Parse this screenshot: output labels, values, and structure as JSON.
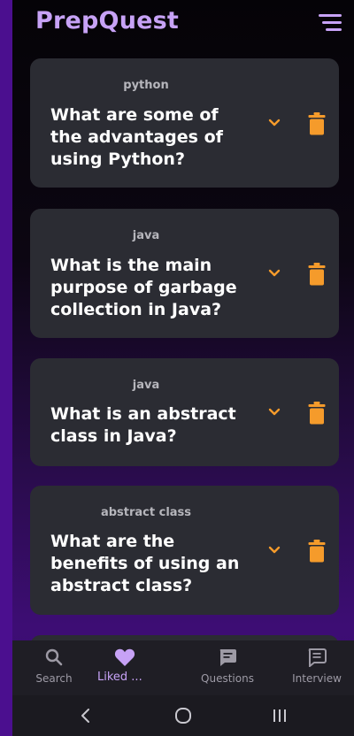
{
  "app": {
    "title": "PrepQuest"
  },
  "cards": [
    {
      "tag": "python",
      "question": "What are some of the advantages of using Python?"
    },
    {
      "tag": "java",
      "question": "What is the main purpose of garbage collection in Java?"
    },
    {
      "tag": "java",
      "question": "What is an abstract class in Java?"
    },
    {
      "tag": "abstract class",
      "question": "What are the benefits of using an abstract class?"
    }
  ],
  "nav": {
    "items": [
      {
        "label": "Search",
        "icon": "search-icon"
      },
      {
        "label": "Liked ...",
        "icon": "heart-icon",
        "active": true
      },
      {
        "label": "Questions",
        "icon": "message-icon"
      },
      {
        "label": "Interview",
        "icon": "chat-icon"
      }
    ]
  },
  "colors": {
    "accent": "#c7a2f6",
    "card": "#2b2c33",
    "action": "#f59b2b"
  }
}
